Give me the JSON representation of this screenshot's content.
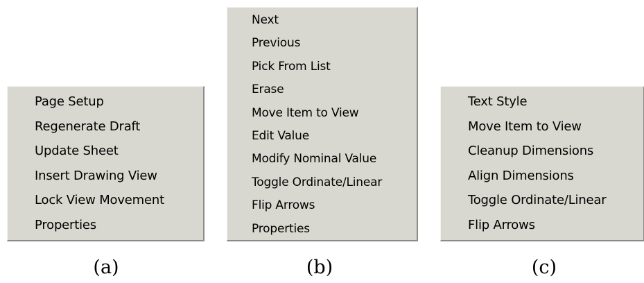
{
  "menus": {
    "a": {
      "items": [
        {
          "label": "Page Setup"
        },
        {
          "label": "Regenerate Draft"
        },
        {
          "label": "Update Sheet"
        },
        {
          "label": "Insert Drawing View"
        },
        {
          "label": "Lock View Movement"
        },
        {
          "label": "Properties"
        }
      ]
    },
    "b": {
      "items": [
        {
          "label": "Next"
        },
        {
          "label": "Previous"
        },
        {
          "label": "Pick From List"
        },
        {
          "label": "Erase"
        },
        {
          "label": "Move Item to View"
        },
        {
          "label": "Edit Value"
        },
        {
          "label": "Modify Nominal Value"
        },
        {
          "label": "Toggle Ordinate/Linear"
        },
        {
          "label": "Flip Arrows"
        },
        {
          "label": "Properties"
        }
      ]
    },
    "c": {
      "items": [
        {
          "label": "Text Style"
        },
        {
          "label": "Move Item to View"
        },
        {
          "label": "Cleanup Dimensions"
        },
        {
          "label": "Align Dimensions"
        },
        {
          "label": "Toggle Ordinate/Linear"
        },
        {
          "label": "Flip Arrows"
        }
      ]
    }
  },
  "captions": {
    "a": "(a)",
    "b": "(b)",
    "c": "(c)"
  },
  "colors": {
    "menu_background": "#d8d8d0",
    "menu_shadow": "#8a8a86",
    "text": "#000000"
  }
}
